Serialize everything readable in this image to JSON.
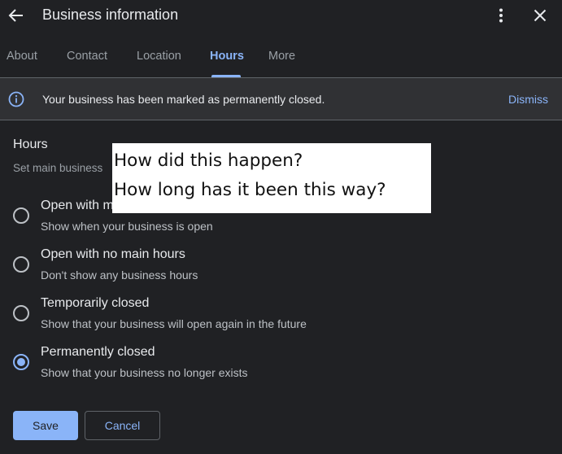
{
  "header": {
    "title": "Business information",
    "back_icon": "arrow-back-icon",
    "more_icon": "more-vert-icon",
    "close_icon": "close-icon"
  },
  "tabs": [
    {
      "label": "About",
      "active": false
    },
    {
      "label": "Contact",
      "active": false
    },
    {
      "label": "Location",
      "active": false
    },
    {
      "label": "Hours",
      "active": true
    },
    {
      "label": "More",
      "active": false
    }
  ],
  "banner": {
    "icon": "info-icon",
    "text": "Your business has been marked as permanently closed.",
    "dismiss_label": "Dismiss"
  },
  "hours": {
    "title": "Hours",
    "subtitle": "Set main business",
    "options": [
      {
        "label": "Open with m",
        "description": "Show when your business is open",
        "selected": false
      },
      {
        "label": "Open with no main hours",
        "description": "Don't show any business hours",
        "selected": false
      },
      {
        "label": "Temporarily closed",
        "description": "Show that your business will open again in the future",
        "selected": false
      },
      {
        "label": "Permanently closed",
        "description": "Show that your business no longer exists",
        "selected": true
      }
    ]
  },
  "actions": {
    "save_label": "Save",
    "cancel_label": "Cancel"
  },
  "annotation": {
    "line1": "How did this happen?",
    "line2": "How long has it been this way?"
  },
  "colors": {
    "background": "#202124",
    "accent": "#8ab4f8",
    "banner_bg": "#303134"
  }
}
